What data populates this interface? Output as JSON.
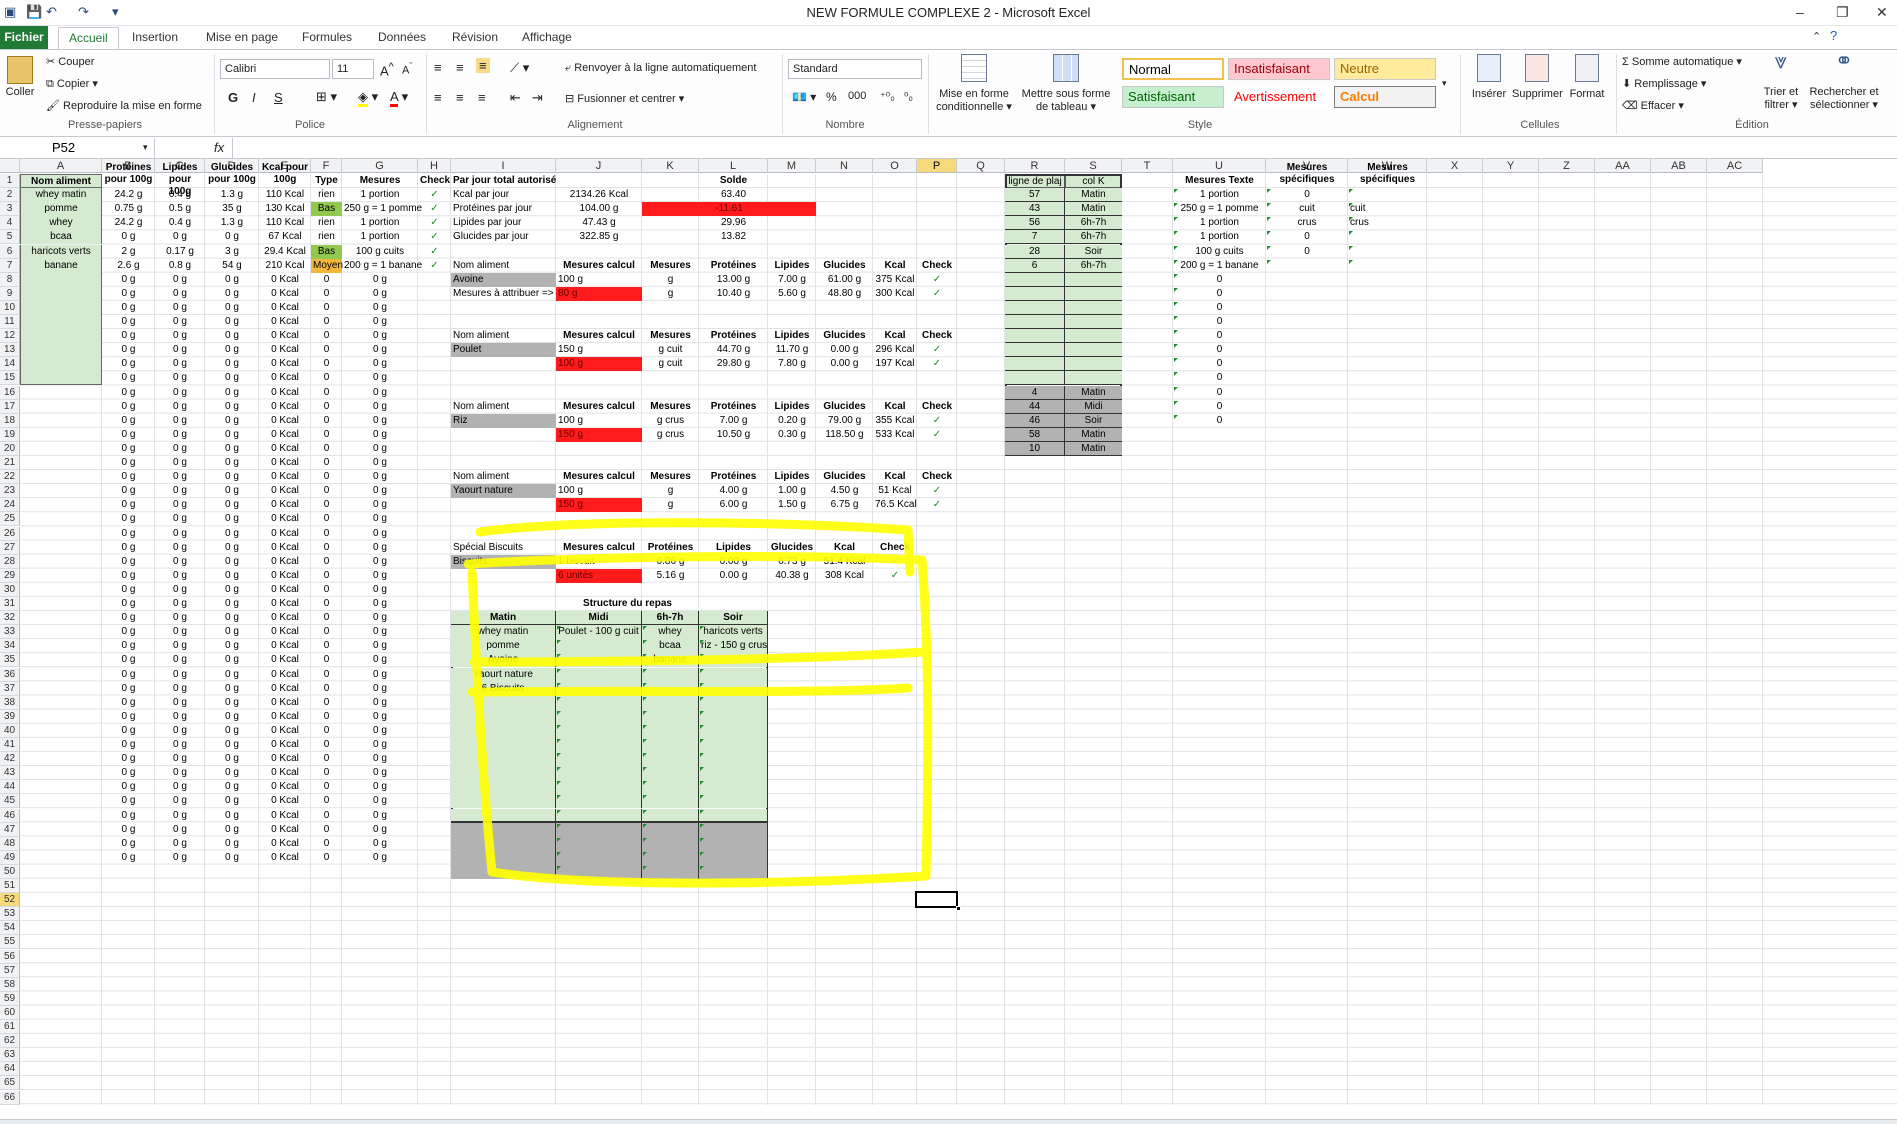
{
  "window": {
    "title": "NEW FORMULE COMPLEXE 2 - Microsoft Excel"
  },
  "menu": {
    "file": "Fichier",
    "tabs": [
      "Accueil",
      "Insertion",
      "Mise en page",
      "Formules",
      "Données",
      "Révision",
      "Affichage"
    ]
  },
  "ribbon": {
    "clipboard": {
      "paste": "Coller",
      "cut": "Couper",
      "copy": "Copier",
      "format_painter": "Reproduire la mise en forme",
      "label": "Presse-papiers"
    },
    "font": {
      "name": "Calibri",
      "size": "11",
      "bold": "G",
      "italic": "I",
      "underline": "S",
      "label": "Police"
    },
    "alignment": {
      "wrap": "Renvoyer à la ligne automatiquement",
      "merge": "Fusionner et centrer",
      "label": "Alignement"
    },
    "number": {
      "format": "Standard",
      "percent": "%",
      "thousands": "000",
      "label": "Nombre"
    },
    "styles": {
      "conditional": "Mise en forme conditionnelle",
      "table": "Mettre sous forme de tableau",
      "label": "Style",
      "normal": "Normal",
      "bad": "Insatisfaisant",
      "neutral": "Neutre",
      "good": "Satisfaisant",
      "warning": "Avertissement",
      "calc": "Calcul"
    },
    "cells": {
      "insert": "Insérer",
      "delete": "Supprimer",
      "format": "Format",
      "label": "Cellules"
    },
    "editing": {
      "autosum": "Somme automatique",
      "fill": "Remplissage",
      "clear": "Effacer",
      "sort": "Trier et filtrer",
      "find": "Rechercher et sélectionner",
      "label": "Édition"
    }
  },
  "formula": {
    "namebox": "P52",
    "fx": "fx",
    "value": ""
  },
  "columns": [
    "A",
    "B",
    "C",
    "D",
    "E",
    "F",
    "G",
    "H",
    "I",
    "J",
    "K",
    "L",
    "M",
    "N",
    "O",
    "P",
    "Q",
    "R",
    "S",
    "T",
    "U",
    "V",
    "W",
    "X",
    "Y",
    "Z",
    "AA",
    "AB",
    "AC"
  ],
  "headers": {
    "a": "Nom aliment",
    "b": "Protéines pour 100g",
    "c": "Lipides pour 100g",
    "d": "Glucides pour 100g",
    "e": "Kcal pour 100g",
    "f": "Type",
    "g": "Mesures",
    "h": "Check",
    "r": "ligne de plaj",
    "s": "col K",
    "u": "Mesures Texte",
    "v": "Mesures spécifiques",
    "w": "Mesures spécifiques"
  },
  "foods": [
    {
      "name": "whey matin",
      "p": "24.2 g",
      "l": "0.4 g",
      "g": "1.3 g",
      "k": "110 Kcal",
      "type": "rien",
      "mes": "1 portion"
    },
    {
      "name": "pomme",
      "p": "0.75 g",
      "l": "0.5 g",
      "g": "35 g",
      "k": "130 Kcal",
      "type": "Bas",
      "mes": "250 g = 1 pomme"
    },
    {
      "name": "whey",
      "p": "24.2 g",
      "l": "0.4 g",
      "g": "1.3 g",
      "k": "110 Kcal",
      "type": "rien",
      "mes": "1 portion"
    },
    {
      "name": "bcaa",
      "p": "0 g",
      "l": "0 g",
      "g": "0 g",
      "k": "67 Kcal",
      "type": "rien",
      "mes": "1 portion"
    },
    {
      "name": "haricots verts",
      "p": "2 g",
      "l": "0.17 g",
      "g": "3 g",
      "k": "29.4 Kcal",
      "type": "Bas",
      "mes": "100 g cuits"
    },
    {
      "name": "banane",
      "p": "2.6 g",
      "l": "0.8 g",
      "g": "54 g",
      "k": "210 Kcal",
      "type": "Moyen",
      "mes": "200 g = 1 banane"
    }
  ],
  "empty": {
    "g": "0 g",
    "k": "0 Kcal",
    "z": "0"
  },
  "check": "✓",
  "daily": {
    "title": "Par jour total autorisé",
    "solde": "Solde",
    "rows": [
      {
        "label": "Kcal par jour",
        "val": "2134.26 Kcal",
        "solde": "63.40"
      },
      {
        "label": "Protéines par jour",
        "val": "104.00 g",
        "solde": "-11.61"
      },
      {
        "label": "Lipides par jour",
        "val": "47.43 g",
        "solde": "29.96"
      },
      {
        "label": "Glucides par jour",
        "val": "322.85 g",
        "solde": "13.82"
      }
    ]
  },
  "blockhdr": {
    "nom": "Nom aliment",
    "mcalc": "Mesures calcul",
    "mes": "Mesures",
    "p": "Protéines",
    "l": "Lipides",
    "g": "Glucides",
    "k": "Kcal",
    "c": "Check"
  },
  "blocks": [
    {
      "name": "Avoine",
      "m1": "100 g",
      "m2": "80 g",
      "u1": "g",
      "u2": "g",
      "p1": "13.00 g",
      "l1": "7.00 g",
      "g1": "61.00 g",
      "k1": "375 Kcal",
      "p2": "10.40 g",
      "l2": "5.60 g",
      "g2": "48.80 g",
      "k2": "300 Kcal",
      "extra": "Mesures à attribuer =>"
    },
    {
      "name": "Poulet",
      "m1": "150 g",
      "m2": "100 g",
      "u1": "g cuit",
      "u2": "g cuit",
      "p1": "44.70 g",
      "l1": "11.70 g",
      "g1": "0.00 g",
      "k1": "296 Kcal",
      "p2": "29.80 g",
      "l2": "7.80 g",
      "g2": "0.00 g",
      "k2": "197 Kcal",
      "extra": ""
    },
    {
      "name": "Riz",
      "m1": "100 g",
      "m2": "150 g",
      "u1": "g crus",
      "u2": "g crus",
      "p1": "7.00 g",
      "l1": "0.20 g",
      "g1": "79.00 g",
      "k1": "355 Kcal",
      "p2": "10.50 g",
      "l2": "0.30 g",
      "g2": "118.50 g",
      "k2": "533 Kcal",
      "extra": ""
    },
    {
      "name": "Yaourt nature",
      "m1": "100 g",
      "m2": "150 g",
      "u1": "g",
      "u2": "g",
      "p1": "4.00 g",
      "l1": "1.00 g",
      "g1": "4.50 g",
      "k1": "51 Kcal",
      "p2": "6.00 g",
      "l2": "1.50 g",
      "g2": "6.75 g",
      "k2": "76.5 Kcal",
      "extra": ""
    }
  ],
  "biscuits": {
    "title": "Spécial Biscuits",
    "mcalc": "Mesures calcul",
    "p": "Protéines",
    "l": "Lipides",
    "g": "Glucides",
    "k": "Kcal",
    "c": "Check",
    "name": "Biscuits",
    "m1": "1 biscuit",
    "m2": "6 unités",
    "p1": "0.86 g",
    "l1": "0.00 g",
    "g1": "6.73 g",
    "k1": "51.4 Kcal",
    "p2": "5.16 g",
    "l2": "0.00 g",
    "g2": "40.38 g",
    "k2": "308 Kcal"
  },
  "meal": {
    "title": "Structure du repas",
    "cols": [
      "Matin",
      "Midi",
      "6h-7h",
      "Soir"
    ],
    "rows": [
      [
        "whey matin",
        "Poulet - 100 g cuit",
        "whey",
        "haricots verts"
      ],
      [
        "pomme",
        "",
        "bcaa",
        "riz - 150 g crus"
      ],
      [
        "Avoine",
        "",
        "banane",
        ""
      ],
      [
        "Yaourt nature",
        "",
        "",
        ""
      ],
      [
        "6 Biscuits",
        "",
        "",
        ""
      ]
    ]
  },
  "rs": [
    [
      "57",
      "Matin"
    ],
    [
      "43",
      "Matin"
    ],
    [
      "56",
      "6h-7h"
    ],
    [
      "7",
      "6h-7h"
    ],
    [
      "28",
      "Soir"
    ],
    [
      "6",
      "6h-7h"
    ]
  ],
  "rs2": [
    [
      "4",
      "Matin"
    ],
    [
      "44",
      "Midi"
    ],
    [
      "46",
      "Soir"
    ],
    [
      "58",
      "Matin"
    ],
    [
      "10",
      "Matin"
    ]
  ],
  "u": [
    "1 portion",
    "250 g = 1 pomme",
    "1 portion",
    "1 portion",
    "100 g cuits",
    "200 g = 1 banane"
  ],
  "v": [
    "0",
    "cuit",
    "crus",
    "0",
    "0",
    ""
  ],
  "w": [
    "",
    "cuit",
    "crus",
    "",
    "",
    ""
  ],
  "rows_count": 66
}
